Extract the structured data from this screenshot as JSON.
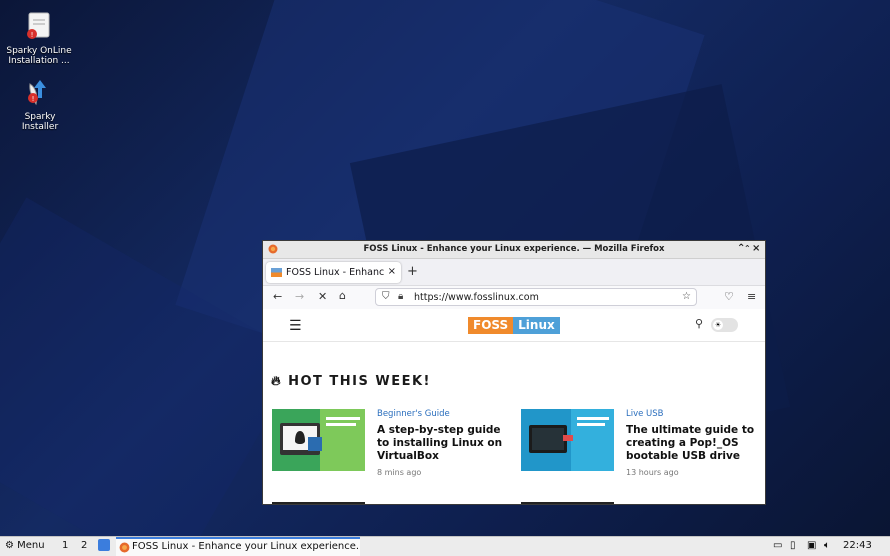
{
  "desktop": {
    "icons": [
      {
        "label": "Sparky OnLine Installation ...",
        "icon": "installer-online-icon"
      },
      {
        "label": "Sparky Installer",
        "icon": "installer-icon"
      }
    ]
  },
  "window": {
    "title": "FOSS Linux - Enhance your Linux experience. — Mozilla Firefox",
    "controls": [
      "‹›",
      "−",
      "×"
    ]
  },
  "browser": {
    "tab_label": "FOSS Linux - Enhance",
    "tab_close": "×",
    "new_tab": "+",
    "url": "https://www.fosslinux.com"
  },
  "site": {
    "logo_left": "FOSS",
    "logo_right": "Linux",
    "section_title": "HOT THIS WEEK!",
    "articles": [
      {
        "category": "Beginner's Guide",
        "title": "A step-by-step guide to installing Linux on VirtualBox",
        "time": "8 mins ago"
      },
      {
        "category": "Live USB",
        "title": "The ultimate guide to creating a Pop!_OS bootable USB drive",
        "time": "13 hours ago"
      }
    ]
  },
  "taskbar": {
    "menu_label": "Menu",
    "workspaces": [
      "1",
      "2"
    ],
    "task_label": "FOSS Linux - Enhance your Linux experience. ...",
    "clock": "22:43"
  },
  "colors": {
    "accent": "#3b7ddd",
    "logo_orange": "#f08a2c",
    "logo_blue": "#4ea0d8"
  }
}
